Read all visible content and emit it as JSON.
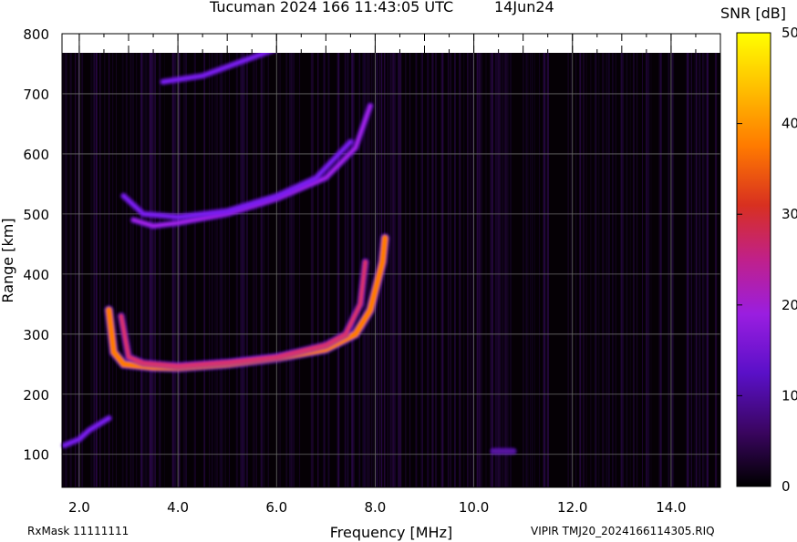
{
  "header": {
    "title": "Tucuman 2024 166 11:43:05 UTC",
    "date": "14Jun24"
  },
  "footer": {
    "rxmask": "RxMask 11111111",
    "file": "VIPIR  TMJ20_2024166114305.RIQ"
  },
  "colors": {
    "background": "#000000",
    "trace_low": "#7a1cf0",
    "trace_mid": "#c0208a",
    "trace_high": "#ff8a00",
    "colorbar_top": "#ffff00"
  },
  "chart_data": {
    "type": "heatmap",
    "title": "Tucuman 2024 166 11:43:05 UTC",
    "xlabel": "Frequency [MHz]",
    "ylabel": "Range [km]",
    "xlim": [
      1.65,
      15.0
    ],
    "ylim": [
      45,
      800
    ],
    "x_ticks": [
      "2.0",
      "4.0",
      "6.0",
      "8.0",
      "10.0",
      "12.0",
      "14.0"
    ],
    "x_tick_values": [
      2,
      4,
      6,
      8,
      10,
      12,
      14
    ],
    "y_ticks": [
      "100",
      "200",
      "300",
      "400",
      "500",
      "600",
      "700",
      "800"
    ],
    "y_tick_values": [
      100,
      200,
      300,
      400,
      500,
      600,
      700,
      800
    ],
    "grid": true,
    "colorbar": {
      "label": "SNR [dB]",
      "range": [
        0,
        50
      ],
      "ticks": [
        "0",
        "10",
        "20",
        "30",
        "40",
        "50"
      ],
      "tick_values": [
        0,
        10,
        20,
        30,
        40,
        50
      ]
    },
    "traces": [
      {
        "name": "F-layer O trace",
        "points": [
          [
            2.6,
            340
          ],
          [
            2.7,
            270
          ],
          [
            2.9,
            250
          ],
          [
            3.5,
            245
          ],
          [
            4.0,
            244
          ],
          [
            5.0,
            250
          ],
          [
            6.0,
            260
          ],
          [
            7.0,
            275
          ],
          [
            7.6,
            300
          ],
          [
            7.9,
            340
          ],
          [
            8.15,
            420
          ],
          [
            8.2,
            460
          ]
        ],
        "snr": 30
      },
      {
        "name": "F-layer X trace",
        "points": [
          [
            2.85,
            330
          ],
          [
            3.0,
            262
          ],
          [
            3.3,
            252
          ],
          [
            4.0,
            247
          ],
          [
            5.0,
            253
          ],
          [
            6.0,
            262
          ],
          [
            7.0,
            282
          ],
          [
            7.4,
            300
          ],
          [
            7.7,
            350
          ],
          [
            7.8,
            420
          ]
        ],
        "snr": 24
      },
      {
        "name": "E trace",
        "points": [
          [
            1.7,
            115
          ],
          [
            2.0,
            125
          ],
          [
            2.2,
            140
          ],
          [
            2.6,
            160
          ]
        ],
        "snr": 14
      },
      {
        "name": "Second hop O trace",
        "points": [
          [
            3.1,
            490
          ],
          [
            3.5,
            480
          ],
          [
            4.0,
            485
          ],
          [
            5.0,
            500
          ],
          [
            6.0,
            525
          ],
          [
            7.0,
            560
          ],
          [
            7.6,
            610
          ],
          [
            7.9,
            680
          ]
        ],
        "snr": 18
      },
      {
        "name": "Second hop X trace",
        "points": [
          [
            2.9,
            530
          ],
          [
            3.3,
            500
          ],
          [
            4.0,
            495
          ],
          [
            5.0,
            505
          ],
          [
            6.0,
            530
          ],
          [
            6.8,
            560
          ],
          [
            7.5,
            620
          ]
        ],
        "snr": 14
      },
      {
        "name": "Third hop trace",
        "points": [
          [
            3.7,
            720
          ],
          [
            4.5,
            730
          ],
          [
            5.5,
            760
          ],
          [
            6.0,
            775
          ]
        ],
        "snr": 12
      },
      {
        "name": "Spot near 10.5 MHz",
        "points": [
          [
            10.4,
            105
          ],
          [
            10.8,
            105
          ]
        ],
        "snr": 8
      }
    ]
  }
}
